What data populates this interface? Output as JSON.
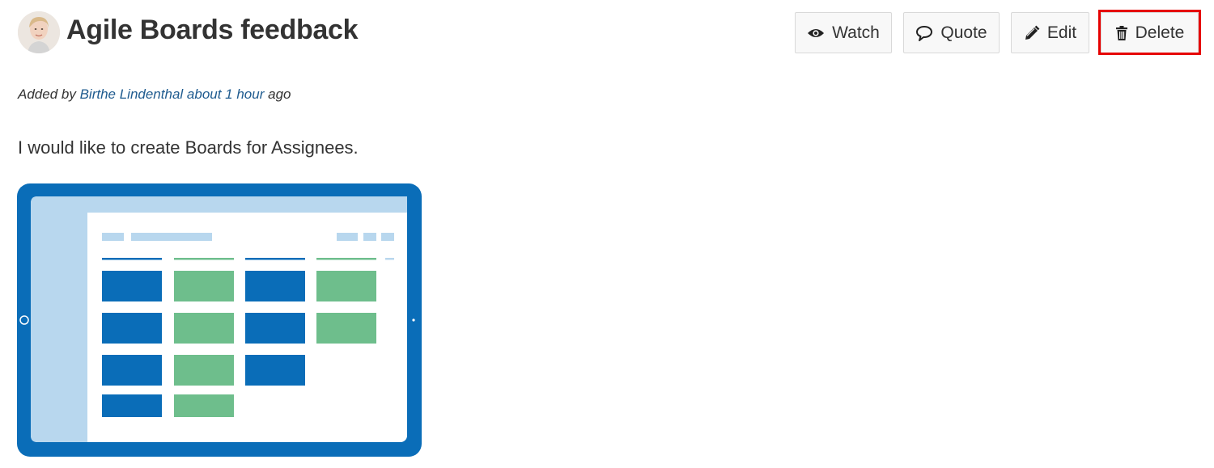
{
  "issue": {
    "title": "Agile Boards feedback",
    "avatar_icon": "user-avatar-photo"
  },
  "toolbar": {
    "watch_label": "Watch",
    "quote_label": "Quote",
    "edit_label": "Edit",
    "delete_label": "Delete",
    "highlight_color": "#e60000"
  },
  "byline": {
    "prefix": "Added by",
    "author": "Birthe Lindenthal",
    "time": "about 1 hour",
    "suffix": "ago"
  },
  "content": {
    "text": "I would like to create Boards for Assignees.",
    "image_icon": "tablet-kanban-board-illustration",
    "colors": {
      "frame": "#0a6db8",
      "sidebar": "#b8d7ee",
      "card_blue": "#0a6db8",
      "card_green": "#6ebe8c"
    }
  }
}
